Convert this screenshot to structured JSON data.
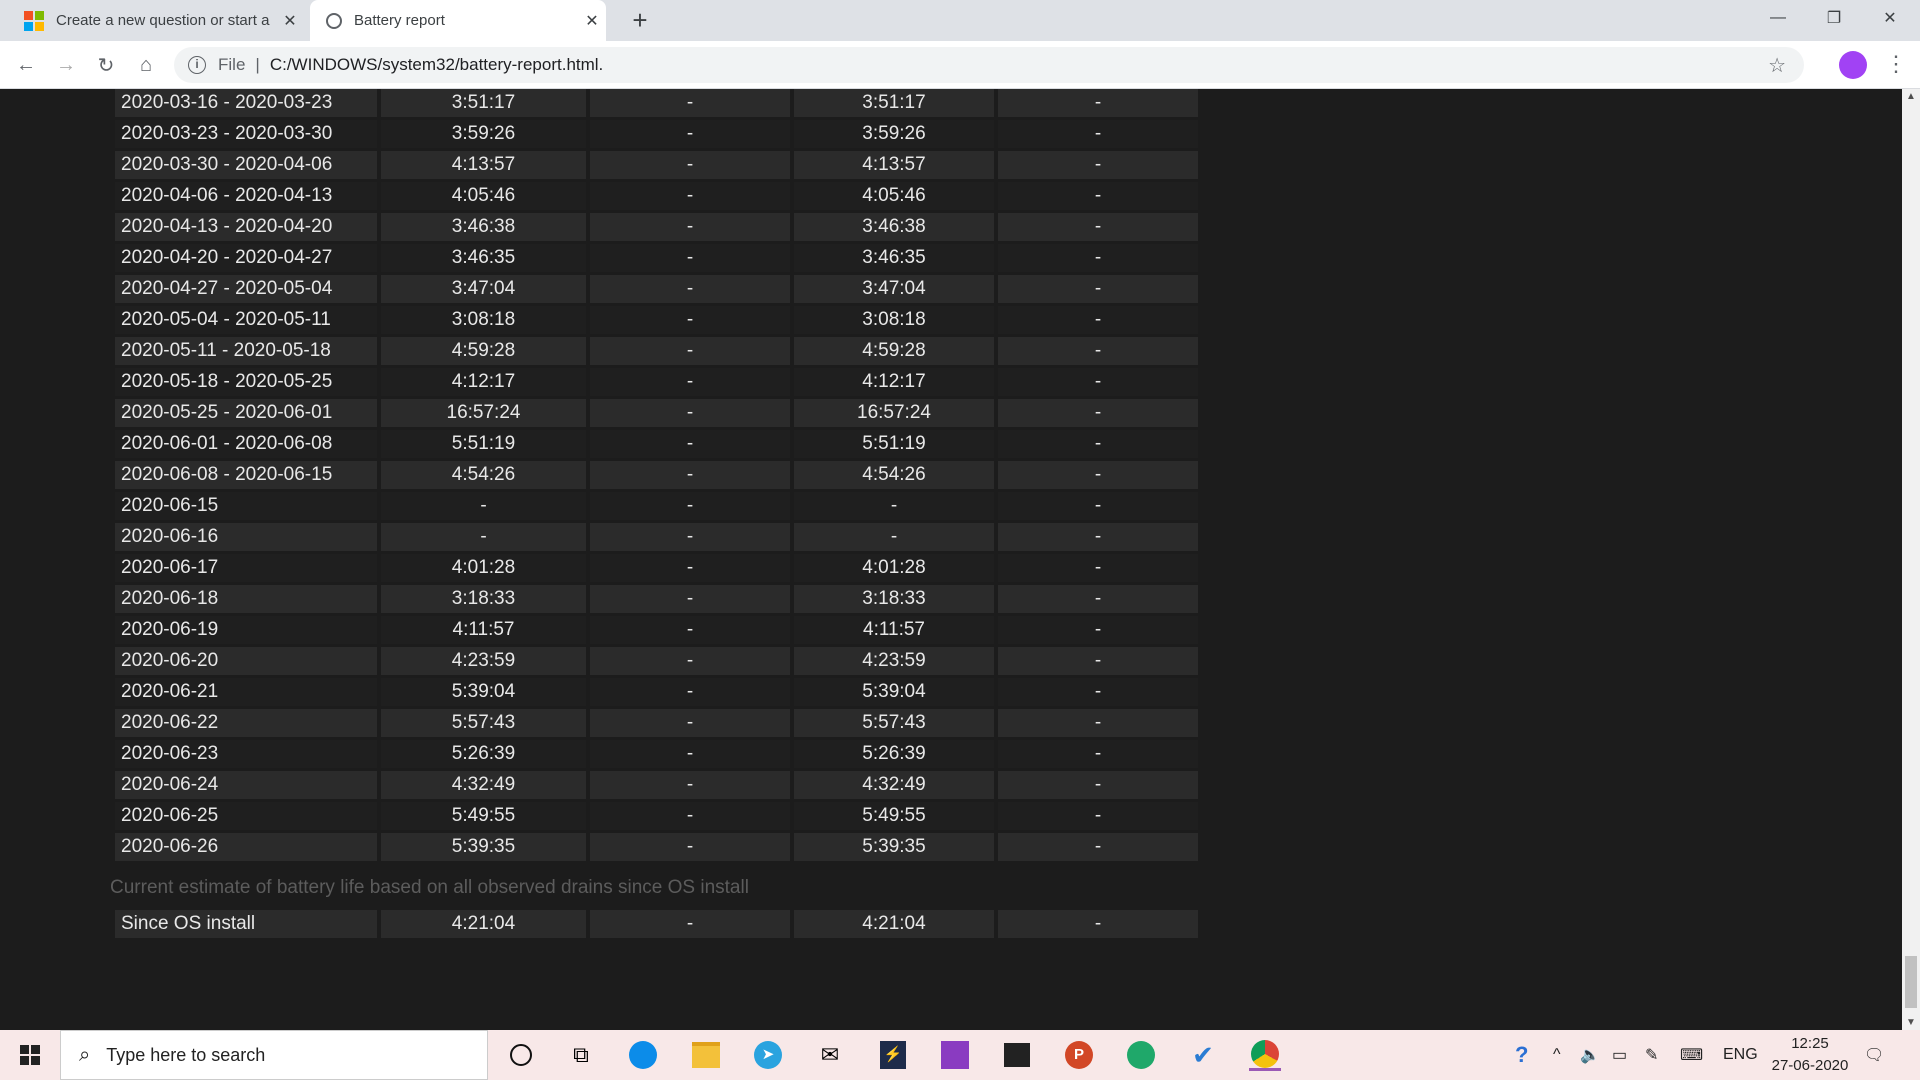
{
  "browser": {
    "tabs": [
      {
        "title": "Create a new question or start a",
        "active": false
      },
      {
        "title": "Battery report",
        "active": true
      }
    ],
    "address": {
      "scheme": "File",
      "path": "C:/WINDOWS/system32/battery-report.html."
    }
  },
  "report": {
    "rows": [
      [
        "2020-03-16 - 2020-03-23",
        "3:51:17",
        "-",
        "3:51:17",
        "-"
      ],
      [
        "2020-03-23 - 2020-03-30",
        "3:59:26",
        "-",
        "3:59:26",
        "-"
      ],
      [
        "2020-03-30 - 2020-04-06",
        "4:13:57",
        "-",
        "4:13:57",
        "-"
      ],
      [
        "2020-04-06 - 2020-04-13",
        "4:05:46",
        "-",
        "4:05:46",
        "-"
      ],
      [
        "2020-04-13 - 2020-04-20",
        "3:46:38",
        "-",
        "3:46:38",
        "-"
      ],
      [
        "2020-04-20 - 2020-04-27",
        "3:46:35",
        "-",
        "3:46:35",
        "-"
      ],
      [
        "2020-04-27 - 2020-05-04",
        "3:47:04",
        "-",
        "3:47:04",
        "-"
      ],
      [
        "2020-05-04 - 2020-05-11",
        "3:08:18",
        "-",
        "3:08:18",
        "-"
      ],
      [
        "2020-05-11 - 2020-05-18",
        "4:59:28",
        "-",
        "4:59:28",
        "-"
      ],
      [
        "2020-05-18 - 2020-05-25",
        "4:12:17",
        "-",
        "4:12:17",
        "-"
      ],
      [
        "2020-05-25 - 2020-06-01",
        "16:57:24",
        "-",
        "16:57:24",
        "-"
      ],
      [
        "2020-06-01 - 2020-06-08",
        "5:51:19",
        "-",
        "5:51:19",
        "-"
      ],
      [
        "2020-06-08 - 2020-06-15",
        "4:54:26",
        "-",
        "4:54:26",
        "-"
      ],
      [
        "2020-06-15",
        "-",
        "-",
        "-",
        "-"
      ],
      [
        "2020-06-16",
        "-",
        "-",
        "-",
        "-"
      ],
      [
        "2020-06-17",
        "4:01:28",
        "-",
        "4:01:28",
        "-"
      ],
      [
        "2020-06-18",
        "3:18:33",
        "-",
        "3:18:33",
        "-"
      ],
      [
        "2020-06-19",
        "4:11:57",
        "-",
        "4:11:57",
        "-"
      ],
      [
        "2020-06-20",
        "4:23:59",
        "-",
        "4:23:59",
        "-"
      ],
      [
        "2020-06-21",
        "5:39:04",
        "-",
        "5:39:04",
        "-"
      ],
      [
        "2020-06-22",
        "5:57:43",
        "-",
        "5:57:43",
        "-"
      ],
      [
        "2020-06-23",
        "5:26:39",
        "-",
        "5:26:39",
        "-"
      ],
      [
        "2020-06-24",
        "4:32:49",
        "-",
        "4:32:49",
        "-"
      ],
      [
        "2020-06-25",
        "5:49:55",
        "-",
        "5:49:55",
        "-"
      ],
      [
        "2020-06-26",
        "5:39:35",
        "-",
        "5:39:35",
        "-"
      ]
    ],
    "estimate_caption": "Current estimate of battery life based on all observed drains since OS install",
    "since_row": [
      "Since OS install",
      "4:21:04",
      "-",
      "4:21:04",
      "-"
    ]
  },
  "taskbar": {
    "search_placeholder": "Type here to search",
    "language": "ENG",
    "time": "12:25",
    "date": "27-06-2020"
  }
}
